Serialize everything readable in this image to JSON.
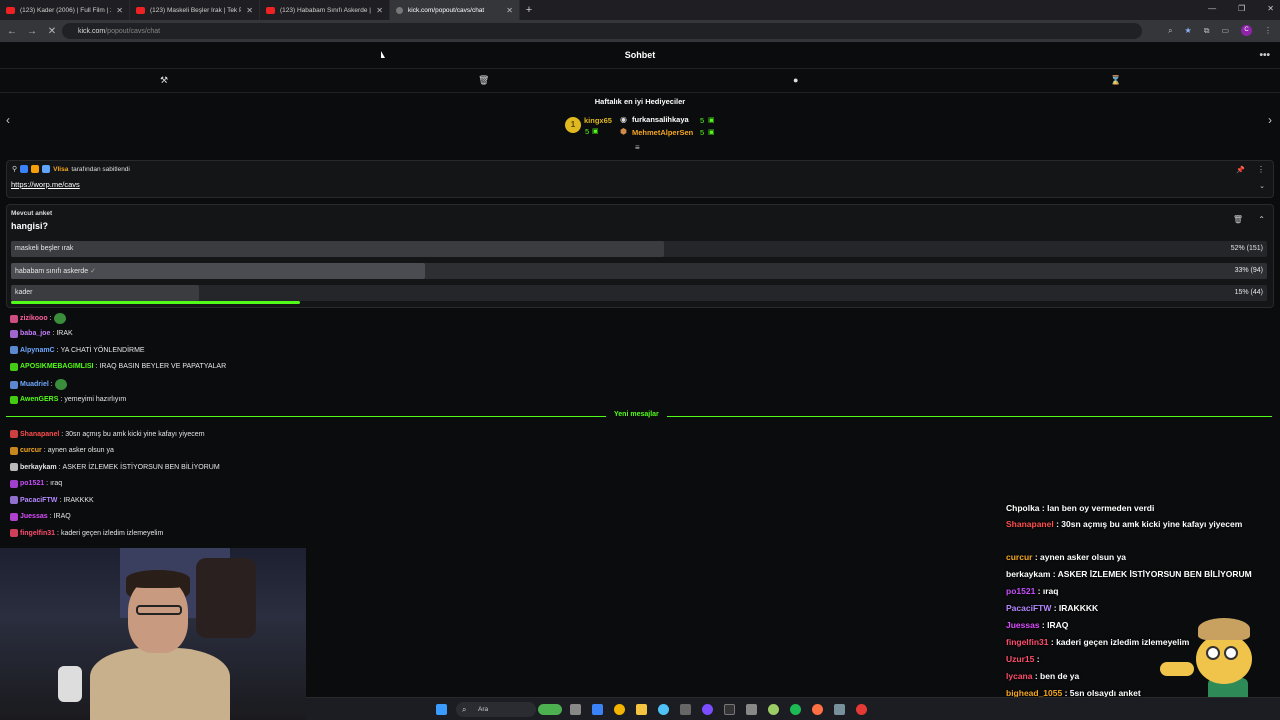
{
  "browser": {
    "tabs": [
      {
        "title": "(123) Kader (2006) | Full Film | 2..."
      },
      {
        "title": "(123) Maskeli Beşler Irak | Tek P..."
      },
      {
        "title": "(123) Hababam Sınıfı Askerde | ..."
      },
      {
        "title": "kick.com/popout/cavs/chat"
      }
    ],
    "url_host": "kick.com",
    "url_path": "/popout/cavs/chat"
  },
  "chat": {
    "header_title": "Sohbet",
    "gifters": {
      "title": "Haftalık en iyi Hediyeciler",
      "rank1": {
        "badge": "1",
        "name": "kingx65",
        "count": "5"
      },
      "rank2": {
        "name": "furkansalihkaya",
        "count": "5"
      },
      "rank3": {
        "name": "MehmetAlperSen",
        "count": "5"
      }
    },
    "pinned": {
      "by_user": "VIisa",
      "by_text": "tarafından sabitlendi",
      "link": "https://worp.me/cavs"
    },
    "poll": {
      "label": "Mevcut anket",
      "question": "hangisi?",
      "options": [
        {
          "name": "maskeli beşler ırak",
          "percent_label": "52% (151)",
          "fraction": 0.52,
          "selected": false
        },
        {
          "name": "hababam sınıfı askerde",
          "percent_label": "33% (94)",
          "fraction": 0.33,
          "selected": true
        },
        {
          "name": "kader",
          "percent_label": "15% (44)",
          "fraction": 0.15,
          "selected": false
        }
      ],
      "time_remaining_fraction": 0.23
    },
    "messages_before": [
      {
        "user": "zizikooo",
        "color": "#ff5fa0",
        "text": ""
      },
      {
        "user": "baba_joe",
        "color": "#c77dff",
        "text": "IRAK"
      },
      {
        "user": "AlpynamC",
        "color": "#6fa8ff",
        "text": "YA CHATİ YÖNLENDİRME"
      },
      {
        "user": "APOSIKMEBAGIMLISI",
        "color": "#53fc18",
        "text": "IRAQ BASIN BEYLER VE PAPATYALAR"
      },
      {
        "user": "Muadriel",
        "color": "#6fa8ff",
        "text": ""
      },
      {
        "user": "AwenGERS",
        "color": "#53fc18",
        "text": "yemeyimi hazırlıyım"
      }
    ],
    "new_messages_label": "Yeni mesajlar",
    "messages_after": [
      {
        "user": "Shanapanel",
        "color": "#ff4d4d",
        "text": "30sn açmış bu amk kicki yine kafayı yiyecem"
      },
      {
        "user": "curcur",
        "color": "#f5a623",
        "text": "aynen asker olsun ya"
      },
      {
        "user": "berkaykam",
        "color": "#e6e6e6",
        "text": "ASKER İZLEMEK İSTİYORSUN BEN BİLİYORUM"
      },
      {
        "user": "po1521",
        "color": "#c84dff",
        "text": "ıraq"
      },
      {
        "user": "PacaciFTW",
        "color": "#b388ff",
        "text": "IRAKKKK"
      },
      {
        "user": "Juessas",
        "color": "#d94dff",
        "text": "IRAQ"
      },
      {
        "user": "fingelfin31",
        "color": "#ff4d6d",
        "text": "kaderi geçen izledim izlemeyelim"
      }
    ]
  },
  "stream_overlay": {
    "lines": [
      {
        "user": "Chpolka",
        "color": "#ffffff",
        "text": "lan ben oy vermeden verdi"
      },
      {
        "user": "Shanapanel",
        "color": "#ff4d4d",
        "text": "30sn açmış bu amk kicki yine kafayı yiyecem"
      },
      {
        "user": "curcur",
        "color": "#f5a623",
        "text": "aynen asker olsun ya"
      },
      {
        "user": "berkaykam",
        "color": "#ffffff",
        "text": "ASKER İZLEMEK İSTİYORSUN BEN BİLİYORUM"
      },
      {
        "user": "po1521",
        "color": "#c84dff",
        "text": "ıraq"
      },
      {
        "user": "PacaciFTW",
        "color": "#b388ff",
        "text": "IRAKKKK"
      },
      {
        "user": "Juessas",
        "color": "#d94dff",
        "text": "IRAQ"
      },
      {
        "user": "fingelfin31",
        "color": "#ff4d6d",
        "text": "kaderi geçen izledim izlemeyelim"
      },
      {
        "user": "Uzur15",
        "color": "#ff4d6d",
        "text": ""
      },
      {
        "user": "lycana",
        "color": "#ff4d6d",
        "text": "ben de ya"
      },
      {
        "user": "bighead_1055",
        "color": "#f5a623",
        "text": "5sn olsaydı anket"
      }
    ]
  },
  "taskbar": {
    "search_label": "Ara"
  },
  "colors": {
    "accent": "#53fc18",
    "background": "#0b0c0d",
    "gold": "#e0b820"
  }
}
